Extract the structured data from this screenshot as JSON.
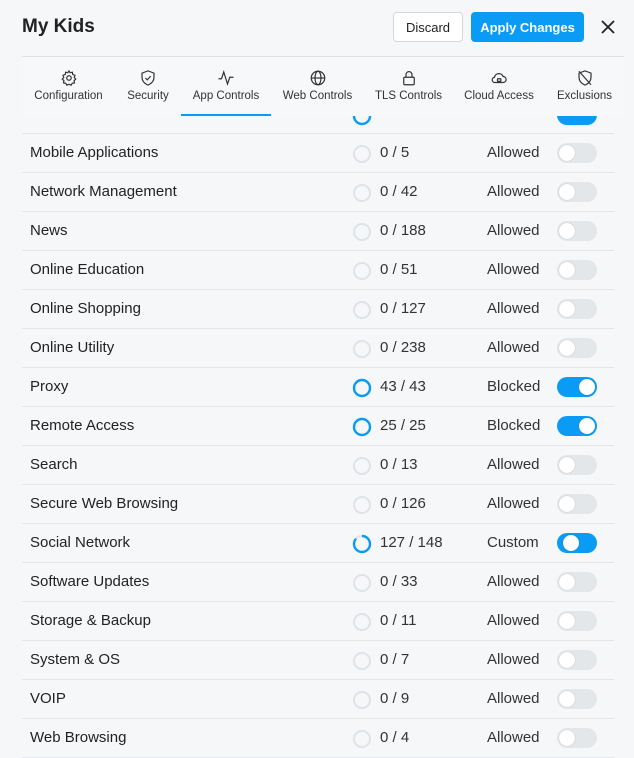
{
  "header": {
    "title": "My Kids",
    "discard_label": "Discard",
    "apply_label": "Apply Changes",
    "close_icon": "close-icon"
  },
  "tabs": [
    {
      "label": "Configuration",
      "icon": "gear-icon",
      "active": false
    },
    {
      "label": "Security",
      "icon": "shield-check-icon",
      "active": false
    },
    {
      "label": "App Controls",
      "icon": "activity-pulse-icon",
      "active": true
    },
    {
      "label": "Web Controls",
      "icon": "globe-icon",
      "active": false
    },
    {
      "label": "TLS Controls",
      "icon": "lock-icon",
      "active": false
    },
    {
      "label": "Cloud Access",
      "icon": "cloud-lock-icon",
      "active": false
    },
    {
      "label": "Exclusions",
      "icon": "shield-off-icon",
      "active": false
    }
  ],
  "colors": {
    "accent": "#0a9cf5",
    "toggle_off": "#e4e7ea",
    "background": "#f5f7f9"
  },
  "apps": [
    {
      "name": "Mobile Applications",
      "count": "0 / 5",
      "status": "Allowed",
      "toggle": "off",
      "progress": 0
    },
    {
      "name": "Network Management",
      "count": "0 / 42",
      "status": "Allowed",
      "toggle": "off",
      "progress": 0
    },
    {
      "name": "News",
      "count": "0 / 188",
      "status": "Allowed",
      "toggle": "off",
      "progress": 0
    },
    {
      "name": "Online Education",
      "count": "0 / 51",
      "status": "Allowed",
      "toggle": "off",
      "progress": 0
    },
    {
      "name": "Online Shopping",
      "count": "0 / 127",
      "status": "Allowed",
      "toggle": "off",
      "progress": 0
    },
    {
      "name": "Online Utility",
      "count": "0 / 238",
      "status": "Allowed",
      "toggle": "off",
      "progress": 0
    },
    {
      "name": "Proxy",
      "count": "43 / 43",
      "status": "Blocked",
      "toggle": "on",
      "progress": 1
    },
    {
      "name": "Remote Access",
      "count": "25 / 25",
      "status": "Blocked",
      "toggle": "on",
      "progress": 1
    },
    {
      "name": "Search",
      "count": "0 / 13",
      "status": "Allowed",
      "toggle": "off",
      "progress": 0
    },
    {
      "name": "Secure Web Browsing",
      "count": "0 / 126",
      "status": "Allowed",
      "toggle": "off",
      "progress": 0
    },
    {
      "name": "Social Network",
      "count": "127 / 148",
      "status": "Custom",
      "toggle": "custom",
      "progress": 0.858
    },
    {
      "name": "Software Updates",
      "count": "0 / 33",
      "status": "Allowed",
      "toggle": "off",
      "progress": 0
    },
    {
      "name": "Storage & Backup",
      "count": "0 / 11",
      "status": "Allowed",
      "toggle": "off",
      "progress": 0
    },
    {
      "name": "System & OS",
      "count": "0 / 7",
      "status": "Allowed",
      "toggle": "off",
      "progress": 0
    },
    {
      "name": "VOIP",
      "count": "0 / 9",
      "status": "Allowed",
      "toggle": "off",
      "progress": 0
    },
    {
      "name": "Web Browsing",
      "count": "0 / 4",
      "status": "Allowed",
      "toggle": "off",
      "progress": 0
    }
  ]
}
